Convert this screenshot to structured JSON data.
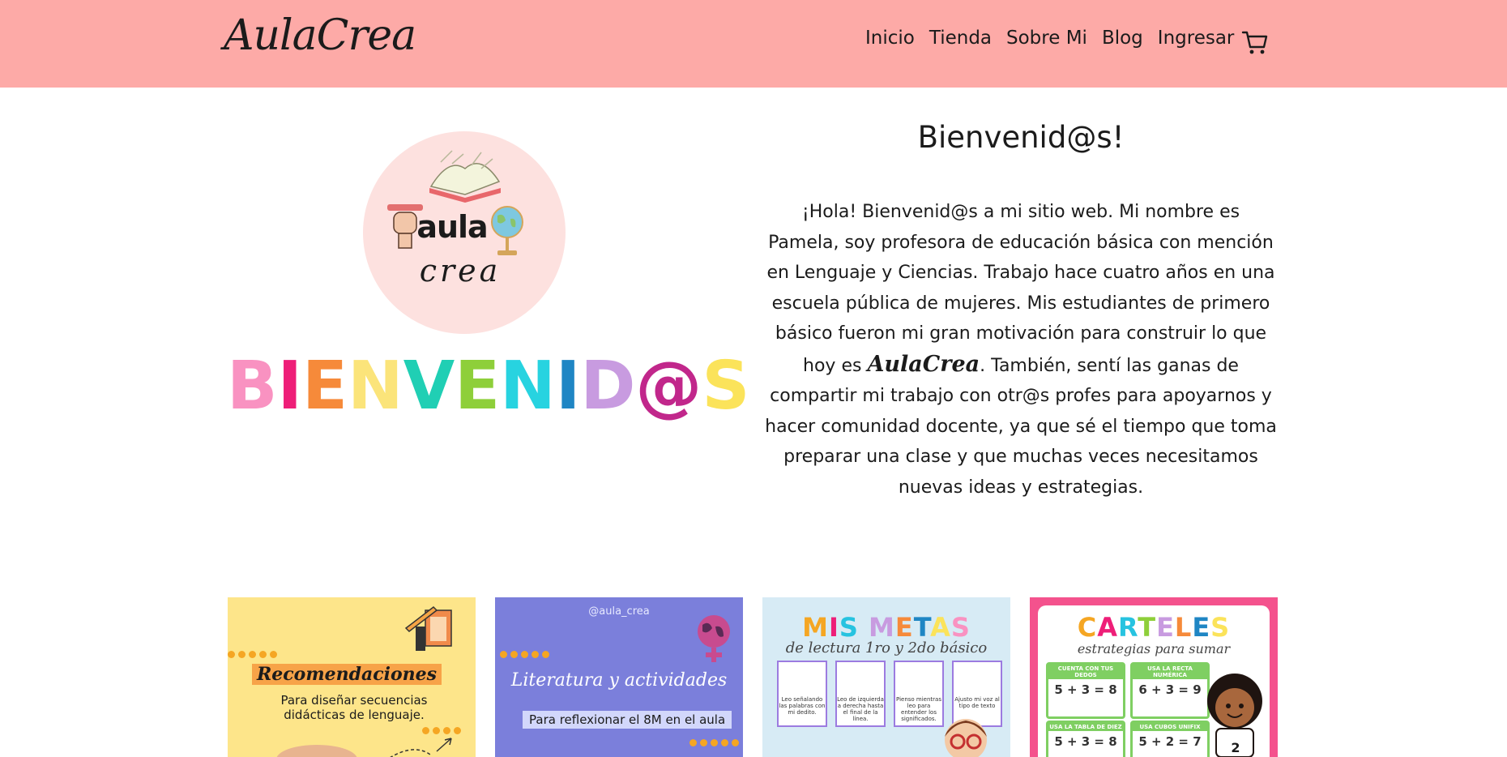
{
  "header": {
    "brand": "AulaCrea",
    "nav": [
      "Inicio",
      "Tienda",
      "Sobre Mi",
      "Blog",
      "Ingresar"
    ],
    "cart_icon": "shopping-cart-icon",
    "background": "#fdaaa7"
  },
  "hero": {
    "logo_line1": "aula",
    "logo_line2": "crea",
    "banner_letters": [
      "B",
      "I",
      "E",
      "N",
      "V",
      "E",
      "N",
      "I",
      "D",
      "@",
      "S"
    ],
    "banner_colors": [
      "#f992c1",
      "#ee1e78",
      "#f68a3a",
      "#fbe47a",
      "#20cfb4",
      "#8ecf3a",
      "#27d3e0",
      "#1f86c4",
      "#c89be0",
      "#c1278b",
      "#fbe35a"
    ],
    "title": "Bienvenid@s!",
    "text_before": "¡Hola! Bienvenid@s a mi sitio web. Mi nombre es Pamela, soy profesora de educación básica con mención en Lenguaje y Ciencias. Trabajo hace cuatro años en una escuela pública de mujeres. Mis estudiantes de primero básico fueron mi gran motivación para construir lo que hoy es",
    "text_brand": "AulaCrea",
    "text_after": ". También, sentí las ganas de compartir mi trabajo con otr@s profes para apoyarnos y hacer comunidad docente, ya que sé el tiempo que toma preparar una clase y que muchas veces necesitamos nuevas ideas y estrategias."
  },
  "cards": [
    {
      "title": "Recomendaciones",
      "subtitle": "Para diseñar secuencias didácticas de lenguaje.",
      "background": "#fde58a"
    },
    {
      "handle": "@aula_crea",
      "title": "Literatura y actividades",
      "subtitle": "Para reflexionar el 8M en el aula",
      "background": "#7b7fdb"
    },
    {
      "title": "MIS METAS",
      "subtitle": "de lectura 1ro y 2do básico",
      "tiles": [
        "Leo señalando las palabras con mi dedito.",
        "Leo de izquierda a derecha hasta el final de la línea.",
        "Pienso mientras leo para entender los significados.",
        "Ajusto mi voz al tipo de texto"
      ],
      "background": "#d7ebf5"
    },
    {
      "title": "CARTELES",
      "subtitle": "estrategias para sumar",
      "boxes": [
        {
          "label": "CUENTA CON TUS DEDOS",
          "eq": "5 + 3 = 8"
        },
        {
          "label": "USA LA RECTA NUMÉRICA",
          "eq": "6 + 3 = 9"
        },
        {
          "label": "USA LA TABLA DE DIEZ",
          "eq": "5 + 3 = 8"
        },
        {
          "label": "USA CUBOS UNIFIX",
          "eq": "5 + 2 = 7"
        }
      ],
      "badge": "2",
      "background": "#f4528d"
    }
  ]
}
